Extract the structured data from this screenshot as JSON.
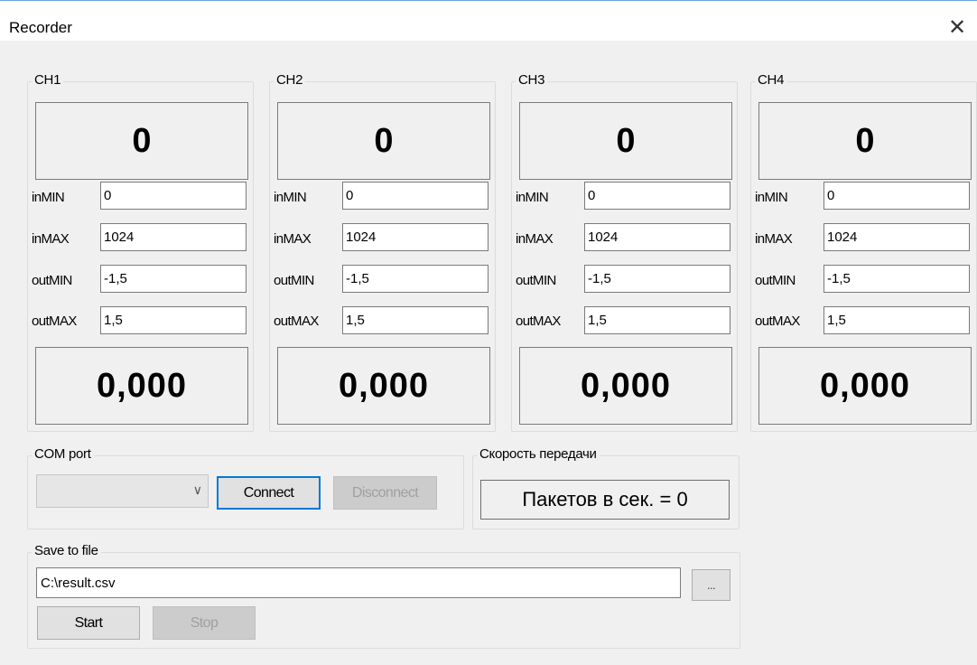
{
  "window": {
    "title": "Recorder",
    "close_glyph": "✕"
  },
  "channels": [
    {
      "name": "CH1",
      "raw_value": "0",
      "in_min": "0",
      "in_max": "1024",
      "out_min": "-1,5",
      "out_max": "1,5",
      "scaled_value": "0,000"
    },
    {
      "name": "CH2",
      "raw_value": "0",
      "in_min": "0",
      "in_max": "1024",
      "out_min": "-1,5",
      "out_max": "1,5",
      "scaled_value": "0,000"
    },
    {
      "name": "CH3",
      "raw_value": "0",
      "in_min": "0",
      "in_max": "1024",
      "out_min": "-1,5",
      "out_max": "1,5",
      "scaled_value": "0,000"
    },
    {
      "name": "CH4",
      "raw_value": "0",
      "in_min": "0",
      "in_max": "1024",
      "out_min": "-1,5",
      "out_max": "1,5",
      "scaled_value": "0,000"
    }
  ],
  "field_labels": {
    "in_min": "inMIN",
    "in_max": "inMAX",
    "out_min": "outMIN",
    "out_max": "outMAX"
  },
  "com_port": {
    "group_label": "COM port",
    "selected": "",
    "connect_label": "Connect",
    "disconnect_label": "Disconnect"
  },
  "speed": {
    "group_label": "Скорость передачи",
    "text": "Пакетов в сек. = 0"
  },
  "save": {
    "group_label": "Save to file",
    "path": "C:\\result.csv",
    "browse_label": "...",
    "start_label": "Start",
    "stop_label": "Stop"
  }
}
